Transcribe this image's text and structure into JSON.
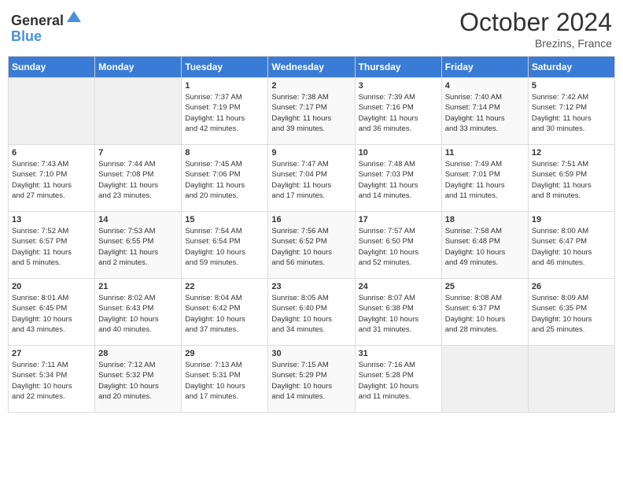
{
  "header": {
    "logo_line1": "General",
    "logo_line2": "Blue",
    "month": "October 2024",
    "location": "Brezins, France"
  },
  "weekdays": [
    "Sunday",
    "Monday",
    "Tuesday",
    "Wednesday",
    "Thursday",
    "Friday",
    "Saturday"
  ],
  "weeks": [
    [
      {
        "day": "",
        "info": ""
      },
      {
        "day": "",
        "info": ""
      },
      {
        "day": "1",
        "info": "Sunrise: 7:37 AM\nSunset: 7:19 PM\nDaylight: 11 hours\nand 42 minutes."
      },
      {
        "day": "2",
        "info": "Sunrise: 7:38 AM\nSunset: 7:17 PM\nDaylight: 11 hours\nand 39 minutes."
      },
      {
        "day": "3",
        "info": "Sunrise: 7:39 AM\nSunset: 7:16 PM\nDaylight: 11 hours\nand 36 minutes."
      },
      {
        "day": "4",
        "info": "Sunrise: 7:40 AM\nSunset: 7:14 PM\nDaylight: 11 hours\nand 33 minutes."
      },
      {
        "day": "5",
        "info": "Sunrise: 7:42 AM\nSunset: 7:12 PM\nDaylight: 11 hours\nand 30 minutes."
      }
    ],
    [
      {
        "day": "6",
        "info": "Sunrise: 7:43 AM\nSunset: 7:10 PM\nDaylight: 11 hours\nand 27 minutes."
      },
      {
        "day": "7",
        "info": "Sunrise: 7:44 AM\nSunset: 7:08 PM\nDaylight: 11 hours\nand 23 minutes."
      },
      {
        "day": "8",
        "info": "Sunrise: 7:45 AM\nSunset: 7:06 PM\nDaylight: 11 hours\nand 20 minutes."
      },
      {
        "day": "9",
        "info": "Sunrise: 7:47 AM\nSunset: 7:04 PM\nDaylight: 11 hours\nand 17 minutes."
      },
      {
        "day": "10",
        "info": "Sunrise: 7:48 AM\nSunset: 7:03 PM\nDaylight: 11 hours\nand 14 minutes."
      },
      {
        "day": "11",
        "info": "Sunrise: 7:49 AM\nSunset: 7:01 PM\nDaylight: 11 hours\nand 11 minutes."
      },
      {
        "day": "12",
        "info": "Sunrise: 7:51 AM\nSunset: 6:59 PM\nDaylight: 11 hours\nand 8 minutes."
      }
    ],
    [
      {
        "day": "13",
        "info": "Sunrise: 7:52 AM\nSunset: 6:57 PM\nDaylight: 11 hours\nand 5 minutes."
      },
      {
        "day": "14",
        "info": "Sunrise: 7:53 AM\nSunset: 6:55 PM\nDaylight: 11 hours\nand 2 minutes."
      },
      {
        "day": "15",
        "info": "Sunrise: 7:54 AM\nSunset: 6:54 PM\nDaylight: 10 hours\nand 59 minutes."
      },
      {
        "day": "16",
        "info": "Sunrise: 7:56 AM\nSunset: 6:52 PM\nDaylight: 10 hours\nand 56 minutes."
      },
      {
        "day": "17",
        "info": "Sunrise: 7:57 AM\nSunset: 6:50 PM\nDaylight: 10 hours\nand 52 minutes."
      },
      {
        "day": "18",
        "info": "Sunrise: 7:58 AM\nSunset: 6:48 PM\nDaylight: 10 hours\nand 49 minutes."
      },
      {
        "day": "19",
        "info": "Sunrise: 8:00 AM\nSunset: 6:47 PM\nDaylight: 10 hours\nand 46 minutes."
      }
    ],
    [
      {
        "day": "20",
        "info": "Sunrise: 8:01 AM\nSunset: 6:45 PM\nDaylight: 10 hours\nand 43 minutes."
      },
      {
        "day": "21",
        "info": "Sunrise: 8:02 AM\nSunset: 6:43 PM\nDaylight: 10 hours\nand 40 minutes."
      },
      {
        "day": "22",
        "info": "Sunrise: 8:04 AM\nSunset: 6:42 PM\nDaylight: 10 hours\nand 37 minutes."
      },
      {
        "day": "23",
        "info": "Sunrise: 8:05 AM\nSunset: 6:40 PM\nDaylight: 10 hours\nand 34 minutes."
      },
      {
        "day": "24",
        "info": "Sunrise: 8:07 AM\nSunset: 6:38 PM\nDaylight: 10 hours\nand 31 minutes."
      },
      {
        "day": "25",
        "info": "Sunrise: 8:08 AM\nSunset: 6:37 PM\nDaylight: 10 hours\nand 28 minutes."
      },
      {
        "day": "26",
        "info": "Sunrise: 8:09 AM\nSunset: 6:35 PM\nDaylight: 10 hours\nand 25 minutes."
      }
    ],
    [
      {
        "day": "27",
        "info": "Sunrise: 7:11 AM\nSunset: 5:34 PM\nDaylight: 10 hours\nand 22 minutes."
      },
      {
        "day": "28",
        "info": "Sunrise: 7:12 AM\nSunset: 5:32 PM\nDaylight: 10 hours\nand 20 minutes."
      },
      {
        "day": "29",
        "info": "Sunrise: 7:13 AM\nSunset: 5:31 PM\nDaylight: 10 hours\nand 17 minutes."
      },
      {
        "day": "30",
        "info": "Sunrise: 7:15 AM\nSunset: 5:29 PM\nDaylight: 10 hours\nand 14 minutes."
      },
      {
        "day": "31",
        "info": "Sunrise: 7:16 AM\nSunset: 5:28 PM\nDaylight: 10 hours\nand 11 minutes."
      },
      {
        "day": "",
        "info": ""
      },
      {
        "day": "",
        "info": ""
      }
    ]
  ]
}
